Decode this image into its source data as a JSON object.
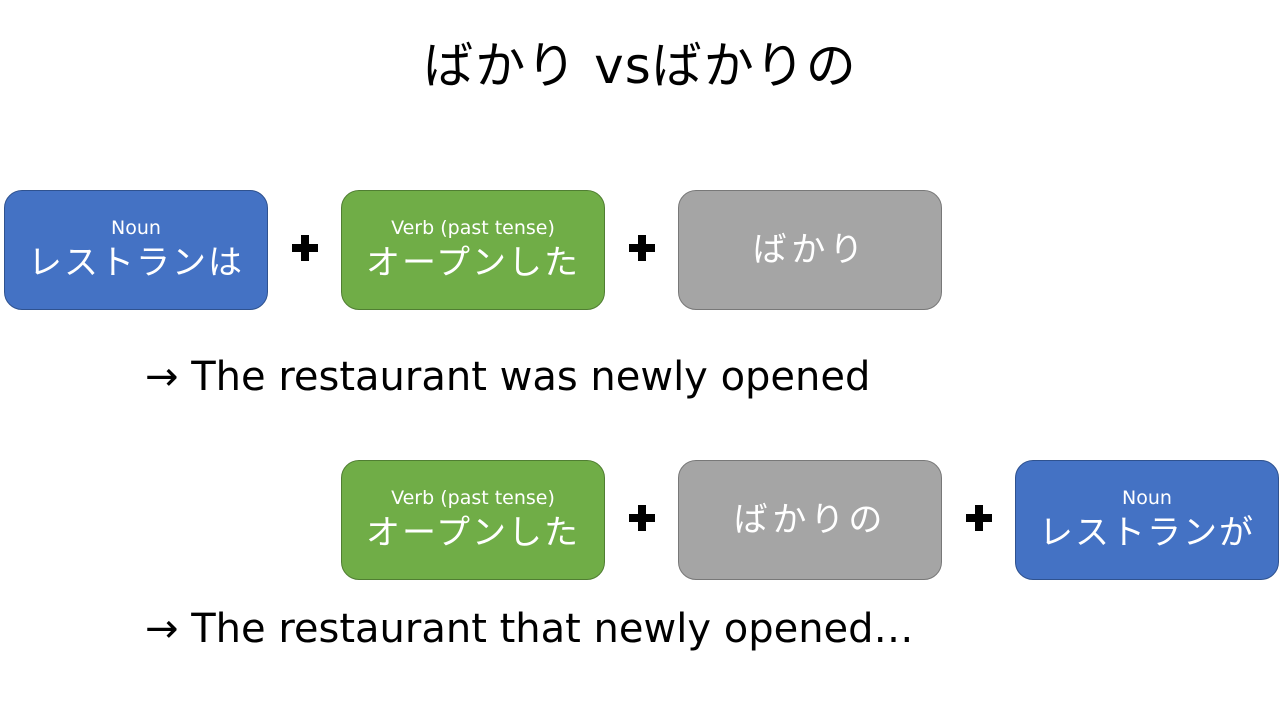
{
  "title": "ばかり vsばかりの",
  "example1": {
    "noun_label": "Noun",
    "noun_text": "レストランは",
    "verb_label": "Verb (past tense)",
    "verb_text": "オープンした",
    "bakari_text": "ばかり",
    "translation": "→ The restaurant was newly opened"
  },
  "example2": {
    "verb_label": "Verb (past tense)",
    "verb_text": "オープンした",
    "bakari_text": "ばかりの",
    "noun_label": "Noun",
    "noun_text": "レストランが",
    "translation": "→ The restaurant that newly opened…"
  },
  "colors": {
    "noun": "#4472c4",
    "verb": "#70ad47",
    "particle": "#a5a5a5"
  }
}
